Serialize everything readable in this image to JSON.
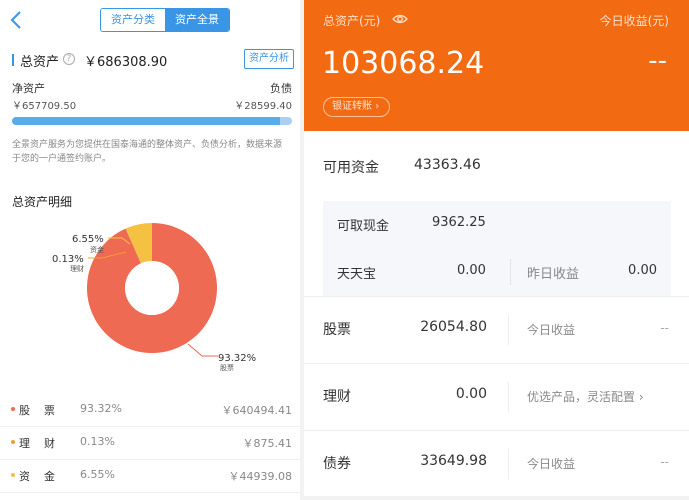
{
  "left": {
    "segment": {
      "tab1": "资产分类",
      "tab2": "资产全景"
    },
    "total_assets": {
      "label": "总资产",
      "value": "￥686308.90",
      "analysis_button": "资产分析"
    },
    "net_assets": {
      "label": "净资产",
      "value": "￥657709.50"
    },
    "liabilities": {
      "label": "负债",
      "value": "￥28599.40"
    },
    "net_ratio": 0.958,
    "description": "全景资产服务为您提供在国泰海通的整体资产、负债分析，数据来源于您的一户通签约账户。",
    "breakdown_title": "总资产明细",
    "donut_labels": {
      "cash_pct": "6.55%",
      "cash_name": "资金",
      "wealth_pct": "0.13%",
      "wealth_name": "理财",
      "stock_pct": "93.32%",
      "stock_name": "股票"
    },
    "assets": [
      {
        "name": "股票",
        "pct": "93.32%",
        "amount": "￥640494.41",
        "color": "#ee6a52"
      },
      {
        "name": "理财",
        "pct": "0.13%",
        "amount": "￥875.41",
        "color": "#f29c38"
      },
      {
        "name": "资金",
        "pct": "6.55%",
        "amount": "￥44939.08",
        "color": "#f5c142"
      }
    ],
    "colors": {
      "accent": "#3a95e6",
      "stock": "#ee6a52",
      "cash": "#f5c142",
      "wealth": "#f29c38"
    }
  },
  "right": {
    "header": {
      "total_label": "总资产(元)",
      "today_label": "今日收益(元)",
      "total_value": "103068.24",
      "today_value": "--",
      "transfer_button": "银证转账"
    },
    "available": {
      "label": "可用资金",
      "value": "43363.46"
    },
    "withdrawable": {
      "label": "可取现金",
      "value": "9362.25"
    },
    "tiantianbao": {
      "label": "天天宝",
      "value": "0.00",
      "yesterday_label": "昨日收益",
      "yesterday_value": "0.00"
    },
    "rows": [
      {
        "name": "股票",
        "amount": "26054.80",
        "sub": "今日收益",
        "right": "--"
      },
      {
        "name": "理财",
        "amount": "0.00",
        "sub": "优选产品，灵活配置"
      },
      {
        "name": "债券",
        "amount": "33649.98",
        "sub": "今日收益",
        "right": "--"
      }
    ],
    "colors": {
      "header": "#f26b13"
    }
  }
}
